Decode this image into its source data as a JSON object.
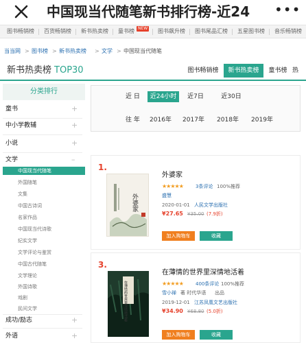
{
  "window": {
    "title": "中国现当代随笔新书排行榜-近24",
    "more": "•••"
  },
  "topnav": [
    "图书畅销榜",
    "百货畅销榜",
    "新书热卖榜",
    "童书榜",
    "图书飙升榜",
    "图书尾品汇榜",
    "五星图书榜",
    "音乐畅销榜"
  ],
  "topnav_tag": "NEW",
  "breadcrumb": [
    "当当网",
    "图书榜",
    "新书热卖榜",
    "文学",
    "中国现当代随笔"
  ],
  "breadcrumb_sep": ">",
  "heading": {
    "main": "新书热卖榜",
    "accent": "TOP30",
    "tabs": [
      "图书畅销榜",
      "新书热卖榜",
      "童书榜",
      "热"
    ],
    "active_tab": "新书热卖榜"
  },
  "sidebar": {
    "title": "分类排行",
    "plus": "+",
    "categories": [
      "童书",
      "中小学教辅",
      "小说",
      "文学",
      "成功/励志",
      "外语"
    ],
    "literature_subs": [
      "中国现当代随笔",
      "外国随笔",
      "文集",
      "中国古诗词",
      "名家作品",
      "中国现当代诗歌",
      "纪实文学",
      "文学评论与鉴赏",
      "中国古代随笔",
      "文学理论",
      "外国诗歌",
      "戏剧",
      "民间文学"
    ],
    "active_sub": "中国现当代随笔"
  },
  "filter": {
    "recent_label": "近 日",
    "recent_options": [
      "近24小时",
      "近7日",
      "近30日"
    ],
    "active_recent": "近24小时",
    "past_label": "往 年",
    "past_options": [
      "2016年",
      "2017年",
      "2018年",
      "2019年"
    ]
  },
  "books": [
    {
      "rank": "1.",
      "title": "外婆家",
      "stars": "★★★★★",
      "reviews": "3条评论",
      "recommend": "100%推荐",
      "author": "盛慧",
      "date": "2020-01-01",
      "publisher": "人民文学出版社",
      "price": "¥27.65",
      "original_price": "¥35.00",
      "discount": "(7.9折)",
      "cart": "加入购物车",
      "favorite": "收藏",
      "cover_text": "外婆家",
      "cover_colors": {
        "bg": "#f4f1ea",
        "accent": "#c23b2a",
        "ink": "#5a6b4f"
      }
    },
    {
      "rank": "3.",
      "title": "在薄情的世界里深情地活着",
      "stars": "★★★★★",
      "reviews": "400条评论",
      "recommend": "100%推荐",
      "author": "雪小禅",
      "author_role": "著 时代华语",
      "producer": "出品",
      "date": "2019-12-01",
      "publisher": "江苏凤凰文艺出版社",
      "price": "¥34.90",
      "original_price": "¥68.80",
      "discount": "(5.0折)",
      "cart": "加入购物车",
      "favorite": "收藏",
      "cover_text": "在薄情的世界里深情地活着",
      "cover_colors": {
        "bg": "#1f3b2c",
        "accent": "#e9e4d4",
        "ink": "#0e2218"
      }
    }
  ],
  "colors": {
    "accent": "#2aa58e",
    "rank": "#e6412b",
    "price": "#e6412b",
    "stars": "#f29c1f",
    "cart_button": "#f07f1f",
    "link": "#2a6fb0"
  }
}
